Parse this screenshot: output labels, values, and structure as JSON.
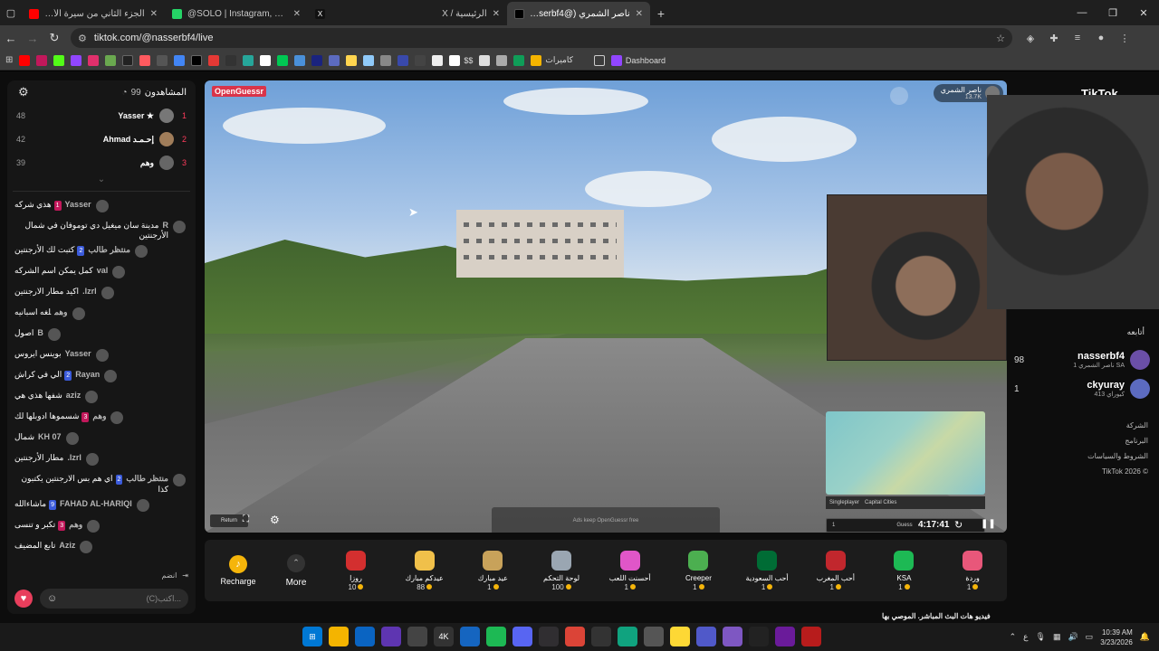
{
  "browser": {
    "tabs": [
      {
        "title": "الجزء الثاني من سيرة الأنبياء | نابلـ",
        "color": "#ff0000"
      },
      {
        "title": "@SOLO | Instagram, TikTok | Lin",
        "color": "#25d366"
      },
      {
        "title": "",
        "color": "#000000"
      },
      {
        "title": "الرئيسية / X",
        "color": "#000000"
      },
      {
        "title": "ناصر الشمري (@nasserbf4) | تيـ",
        "color": "#000000",
        "active": true
      }
    ],
    "new_tab": "+",
    "url": "tiktok.com/@nasserbf4/live",
    "bookmarks": {
      "cameras": "كاميرات",
      "dashboard": "Dashboard",
      "dollar": "$$"
    }
  },
  "chat": {
    "title": "المشاهدون",
    "viewer_count": "99",
    "top_viewers": [
      {
        "rank": "1",
        "name": "Yasser ★",
        "score": "48"
      },
      {
        "rank": "2",
        "name": "Ahmad إحـمـد",
        "score": "42"
      },
      {
        "rank": "3",
        "name": "وهم",
        "score": "39"
      }
    ],
    "messages": [
      {
        "user": "Yasser",
        "badge": "1",
        "text": "هذي شركه"
      },
      {
        "user": "R",
        "badge": "",
        "text": "مدينة سان ميغيل دي توموفان في شمال الأرجنتين"
      },
      {
        "user": "منتظر طالب",
        "badge": "2",
        "text": "كتبت لك الأرجنتين"
      },
      {
        "user": "val",
        "badge": "",
        "text": "كمل يمكن اسم الشركه"
      },
      {
        "user": "Izrl.",
        "badge": "",
        "text": "اكيد مطار الارجنتين"
      },
      {
        "user": "وهم",
        "badge": "",
        "text": "لغه اسبانيه"
      },
      {
        "user": "B",
        "badge": "",
        "text": "اصول"
      },
      {
        "user": "Yasser",
        "badge": "",
        "text": "بوينس ايروس"
      },
      {
        "user": "Rayan",
        "badge": "2",
        "text": "الي في كراش"
      },
      {
        "user": "aziz",
        "badge": "",
        "text": "شفها هذي هي"
      },
      {
        "user": "وهم",
        "badge": "3",
        "text": "شسموها ادوبلها لك"
      },
      {
        "user": "KH 07",
        "badge": "",
        "text": "شمال"
      },
      {
        "user": "Izrl.",
        "badge": "",
        "text": "مطار الأرجنتين"
      },
      {
        "user": "منتظر طالب",
        "badge": "2",
        "text": "اي هم بس الارجنتين يكتبون كذا"
      },
      {
        "user": "FAHAD AL-HARIQI",
        "badge": "9",
        "text": "ماشاءالله"
      },
      {
        "user": "وهم",
        "badge": "3",
        "text": "تكبر و تنسى"
      },
      {
        "user": "Aziz",
        "badge": "",
        "text": "تابع المضيف"
      }
    ],
    "join_text": "انضم",
    "input_placeholder": "اكتب...",
    "input_hint": "(C)"
  },
  "stream": {
    "logo": "OpenGuessr",
    "streamer_name": "ناصر الشمري",
    "likes": "13.7K",
    "return_label": "Return",
    "mode": "Singleplayer",
    "map_name": "Capital Cities",
    "guess_label": "Guess",
    "timer": "4:17:41",
    "tooltip": "Ads keep OpenGuessr free",
    "round": "1"
  },
  "gifts": {
    "recharge_label": "Recharge",
    "more_label": "More",
    "items": [
      {
        "name": "وردة",
        "price": "1",
        "color": "#e8577a"
      },
      {
        "name": "KSA",
        "price": "1",
        "color": "#1db954"
      },
      {
        "name": "أحب المغرب",
        "price": "1",
        "color": "#c1272d"
      },
      {
        "name": "أحب السعودية",
        "price": "1",
        "color": "#006c35"
      },
      {
        "name": "Creeper",
        "price": "1",
        "color": "#4caf50"
      },
      {
        "name": "أحسنت اللعب",
        "price": "1",
        "color": "#e056c8"
      },
      {
        "name": "لوحة التحكم",
        "price": "100",
        "color": "#9aa6b2"
      },
      {
        "name": "عيد مبارك",
        "price": "1",
        "color": "#c8a25a"
      },
      {
        "name": "عيدكم مبارك",
        "price": "88",
        "color": "#f0c04a"
      },
      {
        "name": "روزا",
        "price": "10",
        "color": "#d32f2f"
      }
    ]
  },
  "promo_text": "فيديو هات البث المباشر. الموصي بها",
  "right": {
    "brand": "TikTok",
    "following_title": "أتابعه",
    "follows": [
      {
        "name": "nasserbf4",
        "sub": "ناصر الشمري 1 SA",
        "count": "98"
      },
      {
        "name": "ckyuray",
        "sub": "كيوراي 413",
        "count": "1"
      }
    ],
    "links": [
      "الشركة",
      "البرنامج",
      "الشروط والسياسات",
      "TikTok 2026 ©"
    ]
  },
  "taskbar": {
    "time": "10:39 AM",
    "date": "3/23/2026",
    "lang": "ع"
  }
}
